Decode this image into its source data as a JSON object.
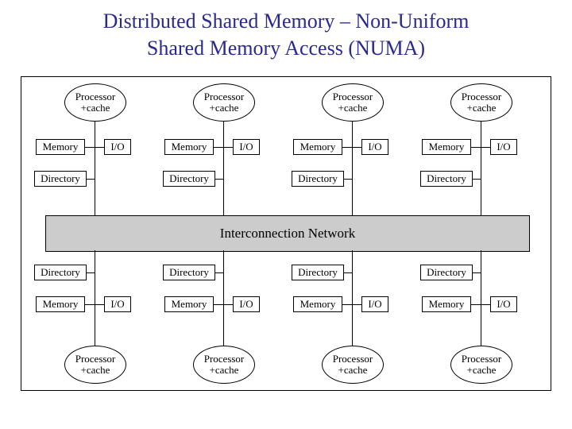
{
  "title_line1": "Distributed Shared Memory – Non-Uniform",
  "title_line2": "Shared Memory Access (NUMA)",
  "labels": {
    "processor_l1": "Processor",
    "processor_l2": "+cache",
    "memory": "Memory",
    "directory": "Directory",
    "io": "I/O",
    "interconnect": "Interconnection Network"
  },
  "layout": {
    "column_count": 4,
    "rows_top": [
      "processor",
      "memory_io",
      "directory"
    ],
    "rows_bottom": [
      "directory",
      "memory_io",
      "processor"
    ]
  }
}
